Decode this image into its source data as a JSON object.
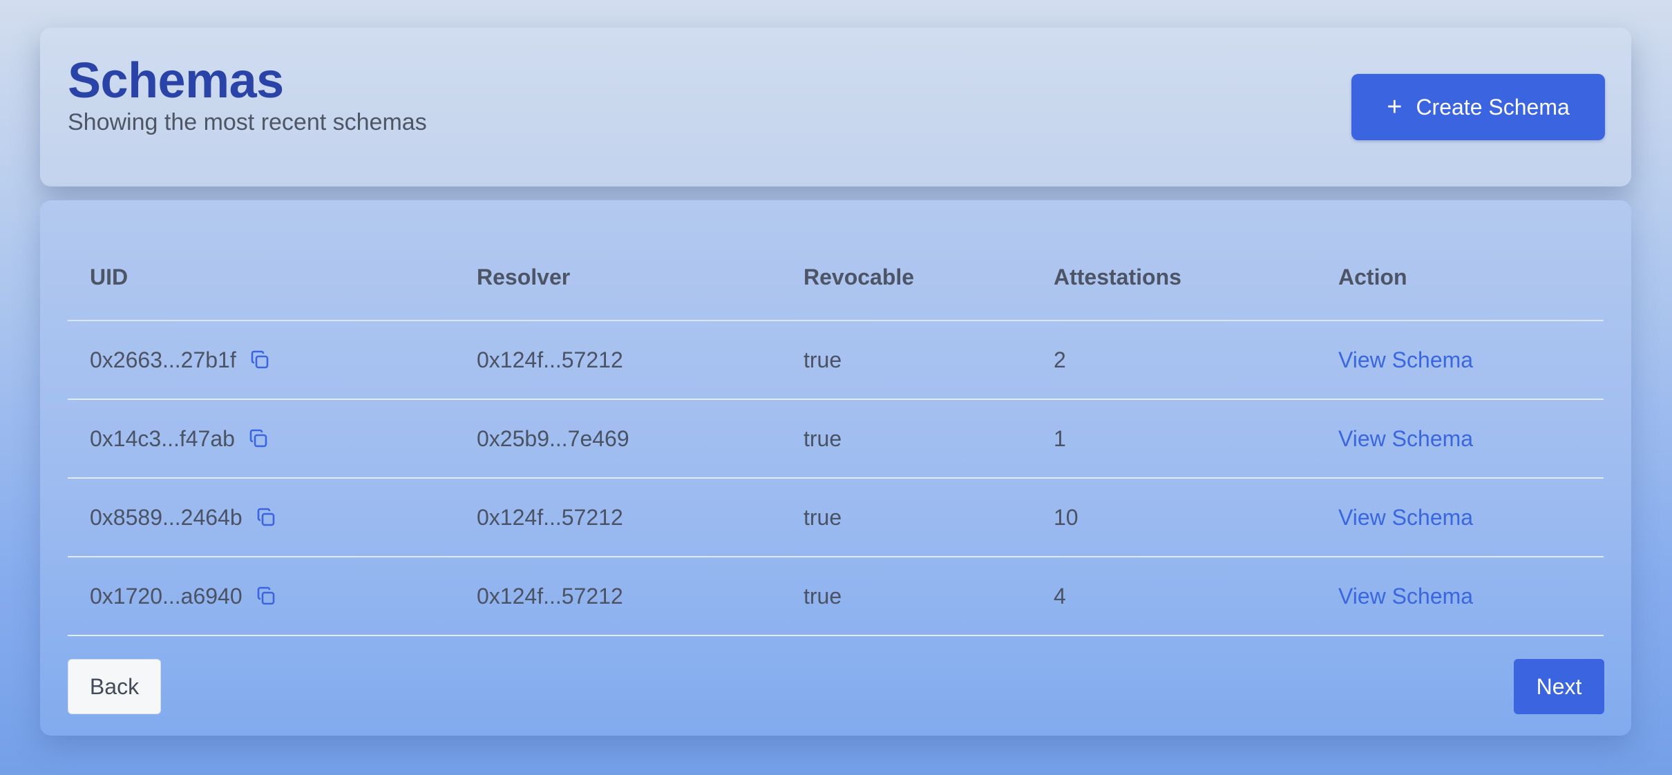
{
  "header": {
    "title": "Schemas",
    "subtitle": "Showing the most recent schemas",
    "create_button_label": "Create Schema",
    "create_button_icon": "plus-icon"
  },
  "table": {
    "columns": {
      "uid": "UID",
      "resolver": "Resolver",
      "revocable": "Revocable",
      "attestations": "Attestations",
      "action": "Action"
    },
    "rows": [
      {
        "uid": "0x2663...27b1f",
        "resolver": "0x124f...57212",
        "revocable": "true",
        "attestations": "2",
        "action": "View Schema"
      },
      {
        "uid": "0x14c3...f47ab",
        "resolver": "0x25b9...7e469",
        "revocable": "true",
        "attestations": "1",
        "action": "View Schema"
      },
      {
        "uid": "0x8589...2464b",
        "resolver": "0x124f...57212",
        "revocable": "true",
        "attestations": "10",
        "action": "View Schema"
      },
      {
        "uid": "0x1720...a6940",
        "resolver": "0x124f...57212",
        "revocable": "true",
        "attestations": "4",
        "action": "View Schema"
      }
    ],
    "copy_icon": "copy-icon"
  },
  "pagination": {
    "back_label": "Back",
    "next_label": "Next"
  },
  "colors": {
    "accent": "#3a64e0",
    "title": "#2a43a6",
    "link": "#3a66e0"
  }
}
